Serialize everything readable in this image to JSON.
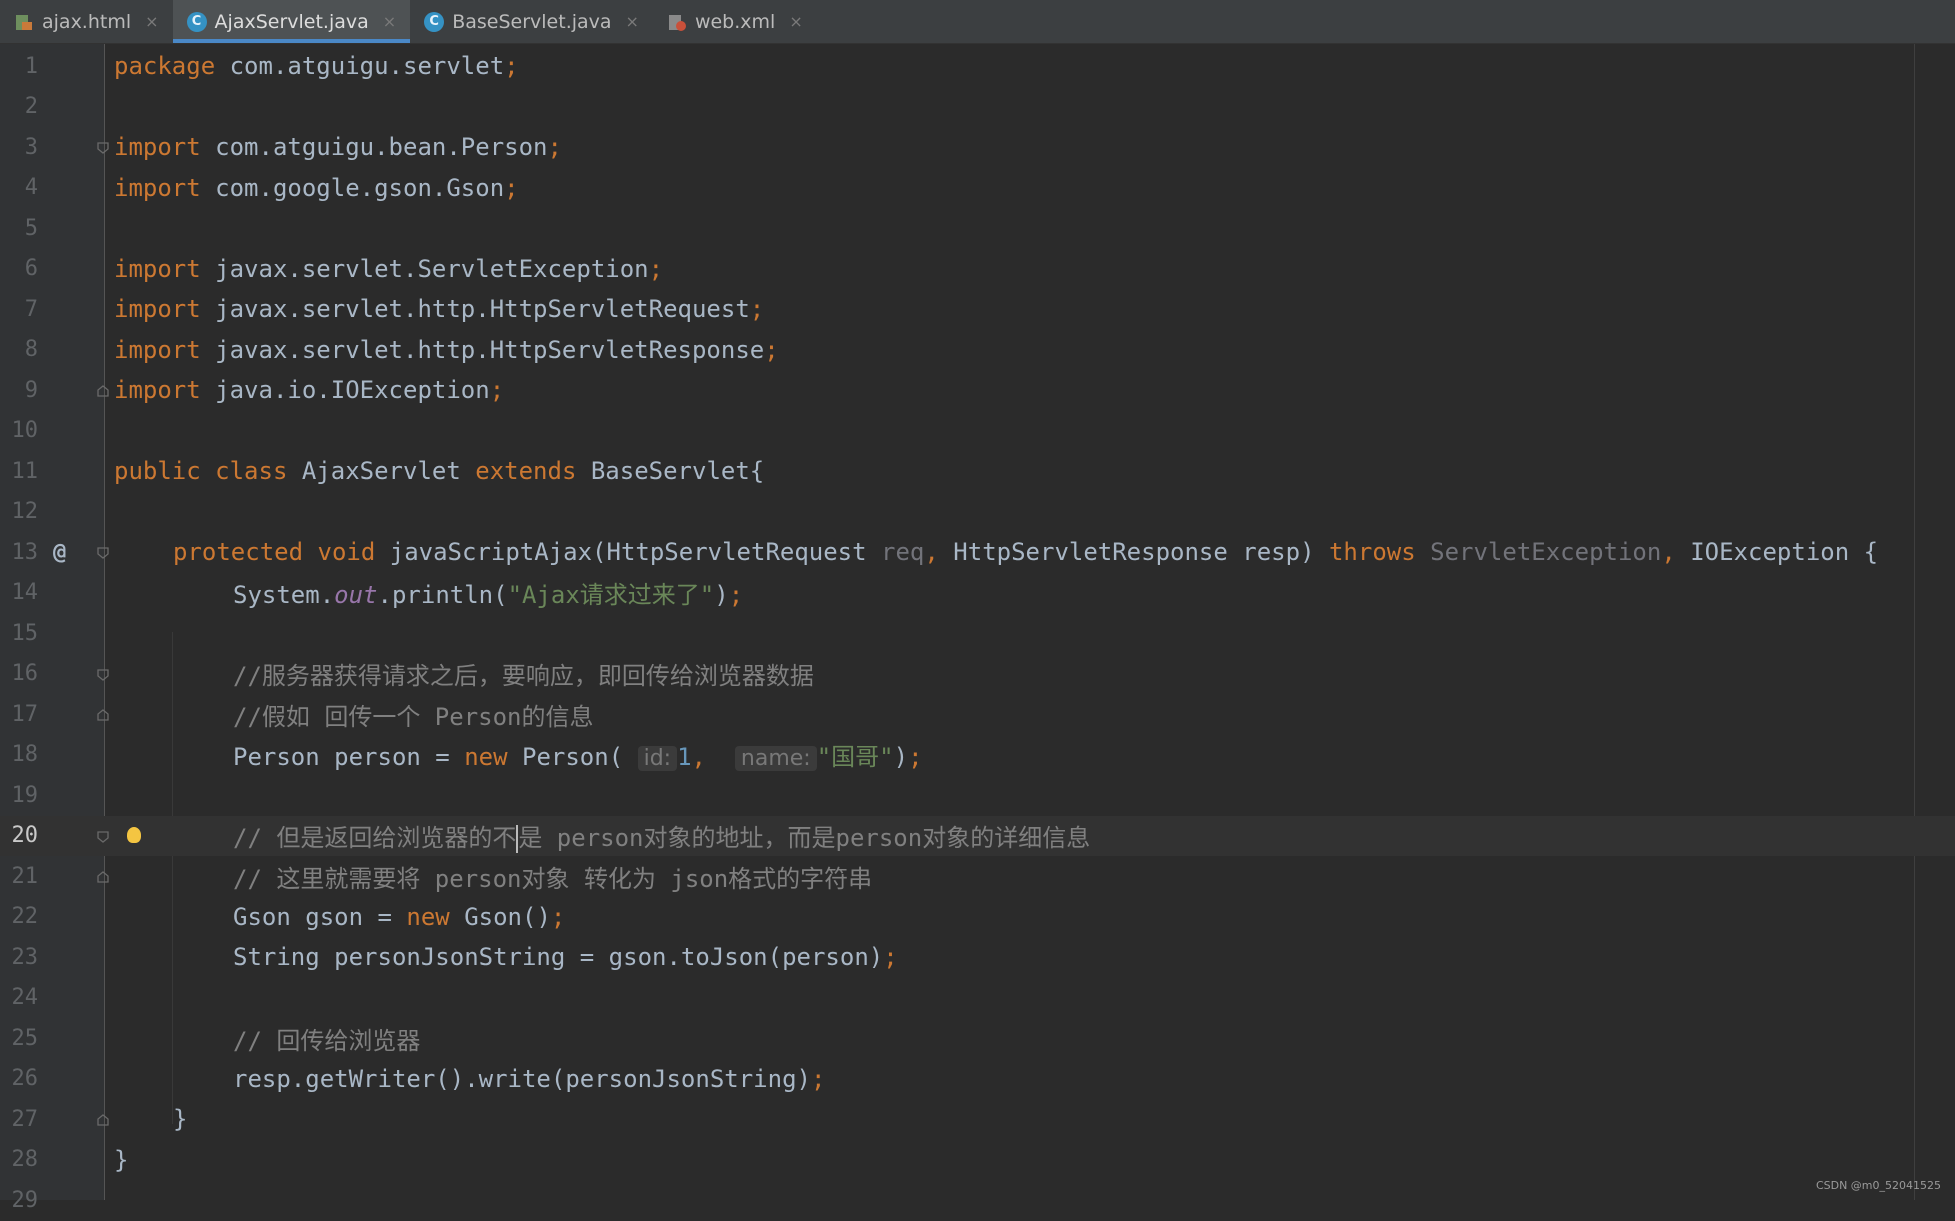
{
  "tabs": [
    {
      "label": "ajax.html",
      "icon": "html-file-icon",
      "active": false
    },
    {
      "label": "AjaxServlet.java",
      "icon": "java-class-icon",
      "active": true
    },
    {
      "label": "BaseServlet.java",
      "icon": "java-class-icon",
      "active": false
    },
    {
      "label": "web.xml",
      "icon": "xml-file-icon",
      "active": false
    }
  ],
  "close_glyph": "×",
  "code": {
    "line_numbers": [
      "1",
      "2",
      "3",
      "4",
      "5",
      "6",
      "7",
      "8",
      "9",
      "10",
      "11",
      "12",
      "13",
      "14",
      "15",
      "16",
      "17",
      "18",
      "19",
      "20",
      "21",
      "22",
      "23",
      "24",
      "25",
      "26",
      "27",
      "28",
      "29"
    ],
    "current_line": "20",
    "override_marker": "@",
    "l1": {
      "kw": "package",
      "rest": " com.atguigu.servlet",
      "semi": ";"
    },
    "l3": {
      "kw": "import",
      "rest": " com.atguigu.bean.Person",
      "semi": ";"
    },
    "l4": {
      "kw": "import",
      "rest": " com.google.gson.Gson",
      "semi": ";"
    },
    "l6": {
      "kw": "import",
      "rest": " javax.servlet.ServletException",
      "semi": ";"
    },
    "l7": {
      "kw": "import",
      "rest": " javax.servlet.http.HttpServletRequest",
      "semi": ";"
    },
    "l8": {
      "kw": "import",
      "rest": " javax.servlet.http.HttpServletResponse",
      "semi": ";"
    },
    "l9": {
      "kw": "import",
      "rest": " java.io.IOException",
      "semi": ";"
    },
    "l11": {
      "kw1": "public",
      "kw2": "class",
      "name": " AjaxServlet ",
      "kw3": "extends",
      "rest": " BaseServlet{"
    },
    "l13": {
      "kw1": "protected",
      "kw2": "void",
      "method": "javaScriptAjax",
      "p1": "(HttpServletRequest ",
      "req": "req",
      "comma1": ",",
      "p2": " HttpServletResponse resp) ",
      "throws": "throws",
      "ex1": " ServletException",
      "comma2": ",",
      "ex2": " IOException {"
    },
    "l14": {
      "a": "System.",
      "out": "out",
      "b": ".println(",
      "str": "\"Ajax请求过来了\"",
      "c": ")",
      "semi": ";"
    },
    "l16": {
      "cmt": "//服务器获得请求之后，要响应，即回传给浏览器数据"
    },
    "l17": {
      "cmt": "//假如 回传一个 Person的信息"
    },
    "l18": {
      "a": "Person person = ",
      "kw": "new",
      "b": " Person(",
      "hint1": "id:",
      "num": "1",
      "comma": ",",
      "hint2": "name:",
      "str": "\"国哥\"",
      "c": ")",
      "semi": ";"
    },
    "l20": {
      "cmt_a": "// 但是返回给浏览器的不",
      "cmt_b": "是 person对象的地址，而是person对象的详细信息"
    },
    "l21": {
      "cmt": "// 这里就需要将 person对象 转化为 json格式的字符串"
    },
    "l22": {
      "a": "Gson gson = ",
      "kw": "new",
      "b": " Gson()",
      "semi": ";"
    },
    "l23": {
      "a": "String personJsonString = gson.toJson(person)",
      "semi": ";"
    },
    "l25": {
      "cmt": "// 回传给浏览器"
    },
    "l26": {
      "a": "resp.getWriter().write(personJsonString)",
      "semi": ";"
    },
    "l27": {
      "a": "}"
    },
    "l28": {
      "a": "}"
    }
  },
  "watermark": "CSDN @m0_52041525"
}
